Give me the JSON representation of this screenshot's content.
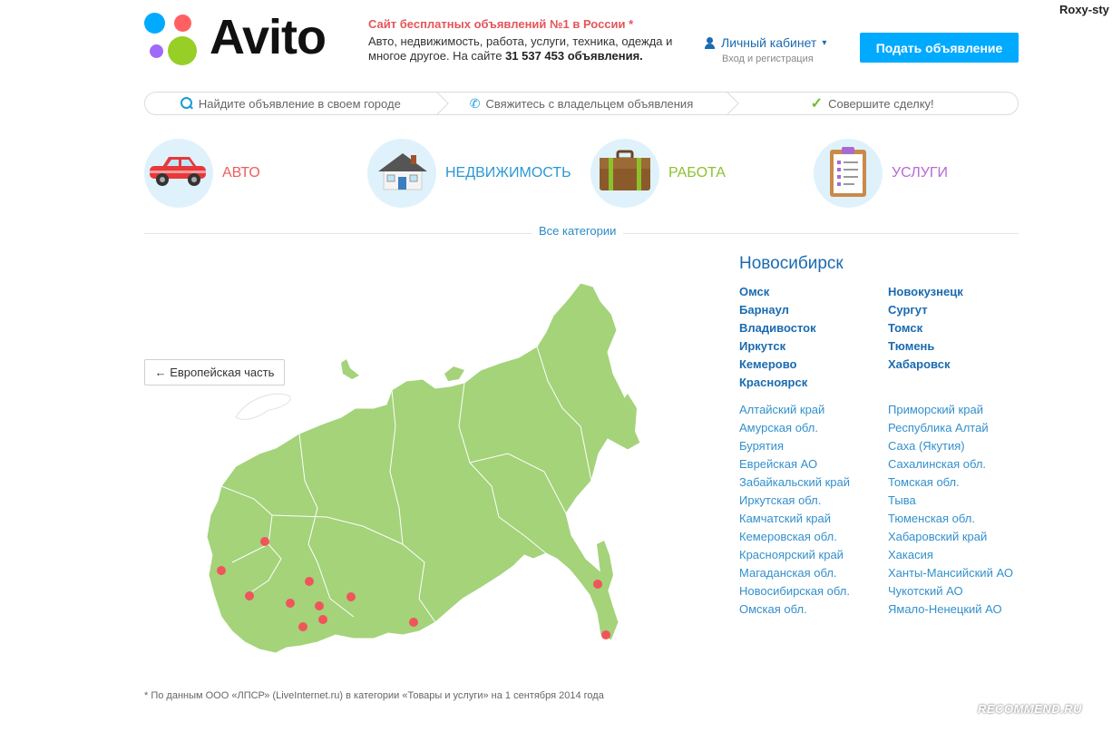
{
  "user_tag": "Roxy-sty",
  "logo": {
    "text": "Avito"
  },
  "tagline": {
    "line1": "Сайт бесплатных объявлений №1 в России *",
    "line2": "Авто, недвижимость, работа, услуги, техника, одежда и многое другое. На сайте ",
    "count": "31 537 453 объявления."
  },
  "cabinet": {
    "label": "Личный кабинет",
    "sub": "Вход и регистрация",
    "caret": "▾"
  },
  "post_button": "Подать объявление",
  "steps": [
    {
      "label": "Найдите объявление в своем городе",
      "icon": "search-icon"
    },
    {
      "label": "Свяжитесь с владельцем объявления",
      "icon": "phone-icon"
    },
    {
      "label": "Совершите сделку!",
      "icon": "check-icon"
    }
  ],
  "categories": [
    {
      "label": "АВТО",
      "icon": "car-icon",
      "color": "#ee5e5e"
    },
    {
      "label": "НЕДВИЖИМОСТЬ",
      "icon": "house-icon",
      "color": "#2a98d4"
    },
    {
      "label": "РАБОТА",
      "icon": "briefcase-icon",
      "color": "#8cc12c"
    },
    {
      "label": "УСЛУГИ",
      "icon": "clipboard-icon",
      "color": "#b869d4"
    }
  ],
  "all_categories": "Все категории",
  "euro_button": "← Европейская часть",
  "region": {
    "title": "Новосибирск",
    "cities_left": [
      "Омск",
      "Барнаул",
      "Владивосток",
      "Иркутск",
      "Кемерово",
      "Красноярск"
    ],
    "cities_right": [
      "Новокузнецк",
      "Сургут",
      "Томск",
      "Тюмень",
      "Хабаровск"
    ],
    "regions_left": [
      "Алтайский край",
      "Амурская обл.",
      "Бурятия",
      "Еврейская АО",
      "Забайкальский край",
      "Иркутская обл.",
      "Камчатский край",
      "Кемеровская обл.",
      "Красноярский край",
      "Магаданская обл.",
      "Новосибирская обл.",
      "Омская обл."
    ],
    "regions_right": [
      "Приморский край",
      "Республика Алтай",
      "Саха (Якутия)",
      "Сахалинская обл.",
      "Томская обл.",
      "Тыва",
      "Тюменская обл.",
      "Хабаровский край",
      "Хакасия",
      "Ханты-Мансийский АО",
      "Чукотский АО",
      "Ямало-Ненецкий АО"
    ]
  },
  "footnote": "* По данным ООО «ЛПСР» (LiveInternet.ru) в категории «Товары и услуги» на 1 сентября 2014 года",
  "watermark": "RECOMMEND.RU",
  "colors": {
    "accent": "#00aaff",
    "link": "#1a6bb0",
    "map_fill": "#a4d37a",
    "map_dot": "#f0555b"
  }
}
